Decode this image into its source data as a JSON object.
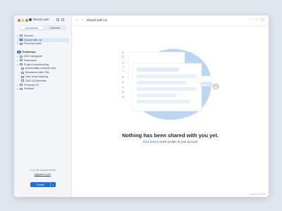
{
  "window": {
    "user_name": "Devon Lane"
  },
  "colors": {
    "accent": "#1d6fd8",
    "illustration_blob": "#bcd5f3",
    "traffic_red": "#f26b5e",
    "traffic_yellow": "#f5bd4f",
    "traffic_green": "#5ec24e"
  },
  "sidebar": {
    "tabs": [
      "Documents",
      "Calendar"
    ],
    "items": [
      {
        "label": "Receive",
        "level": 0,
        "expanded": true
      },
      {
        "label": "Shared with me",
        "level": 0,
        "selected": true
      },
      {
        "label": "Personal notes",
        "level": 0
      },
      {
        "label": "Roadmaps",
        "level": 0,
        "group": true
      },
      {
        "label": "2022 styleguide",
        "level": 0
      },
      {
        "label": "Resources",
        "level": 0
      },
      {
        "label": "Project brainstorming",
        "level": 0,
        "expanded": true
      },
      {
        "label": "Accessibility contrast rules",
        "level": 1
      },
      {
        "label": "Brainstorm with PMs",
        "level": 1
      },
      {
        "label": "User story mapping",
        "level": 1
      },
      {
        "label": "2022 Q3 timelines",
        "level": 1
      },
      {
        "label": "Previews 2.0",
        "level": 0
      },
      {
        "label": "Archived",
        "level": 0
      }
    ],
    "limit_text": "27 of 30 document limit",
    "upgrade_label": "Upgrade to pro",
    "create_label": "Create"
  },
  "header": {
    "title": "Shared with me",
    "back_label": "←",
    "forward_label": "→"
  },
  "empty_state": {
    "title": "Nothing has been shared with you yet.",
    "link_label": "Click here",
    "rest": "to invite people to your account"
  },
  "footer": {
    "powered_by": "Powered by Atlaft"
  }
}
